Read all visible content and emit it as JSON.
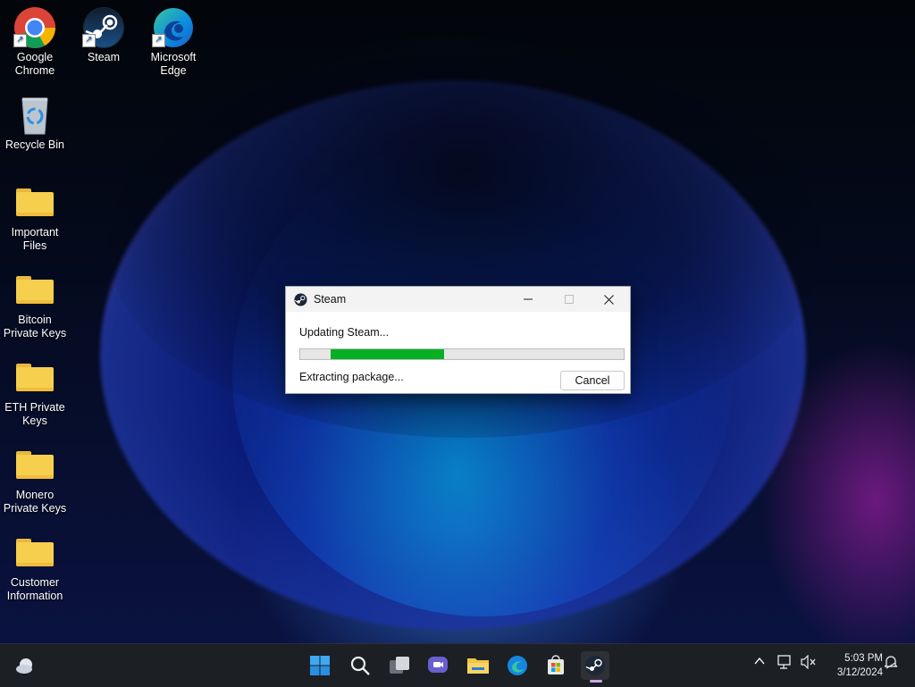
{
  "desktop": {
    "icons": [
      {
        "label": "Google Chrome",
        "icon": "chrome-icon"
      },
      {
        "label": "Steam",
        "icon": "steam-icon"
      },
      {
        "label": "Microsoft Edge",
        "icon": "edge-icon"
      },
      {
        "label": "Recycle Bin",
        "icon": "recycle-bin-icon"
      },
      {
        "label": "Important Files",
        "icon": "folder-icon"
      },
      {
        "label": "Bitcoin Private Keys",
        "icon": "folder-icon"
      },
      {
        "label": "ETH Private Keys",
        "icon": "folder-icon"
      },
      {
        "label": "Monero Private Keys",
        "icon": "folder-icon"
      },
      {
        "label": "Customer Information",
        "icon": "folder-icon"
      }
    ]
  },
  "dialog": {
    "title": "Steam",
    "status": "Updating Steam...",
    "progress_start": 0.095,
    "progress_end": 0.445,
    "progress_color": "#06b025",
    "detail": "Extracting package...",
    "cancel_label": "Cancel"
  },
  "taskbar": {
    "items": [
      "weather-icon",
      "start-icon",
      "search-icon",
      "task-view-icon",
      "chat-icon",
      "file-explorer-icon",
      "edge-icon",
      "store-icon",
      "steam-icon"
    ],
    "active": "steam-icon",
    "tray": [
      "chevron-up-icon",
      "network-icon",
      "volume-muted-icon",
      "notification-icon"
    ],
    "time": "5:03 PM",
    "date": "3/12/2024"
  }
}
